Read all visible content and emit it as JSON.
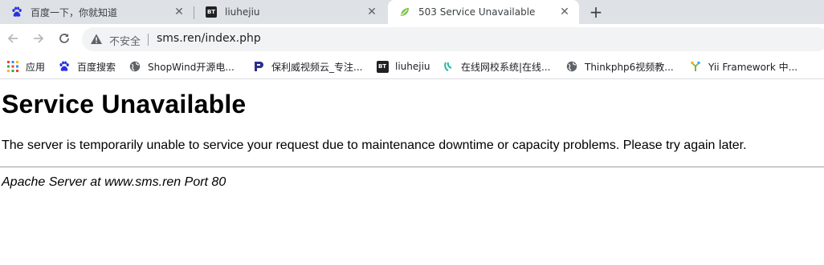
{
  "tabs": [
    {
      "title": "百度一下，你就知道",
      "icon": "baidu-paw-icon"
    },
    {
      "title": "liuhejiu",
      "icon": "bt-icon"
    },
    {
      "title": "503 Service Unavailable",
      "icon": "leaf-icon",
      "active": true
    }
  ],
  "tab_close_glyph": "✕",
  "new_tab_glyph": "+",
  "bt_badge": "BT",
  "address_bar": {
    "security_label": "不安全",
    "url": "sms.ren/index.php"
  },
  "bookmarks": [
    {
      "label": "应用",
      "icon": "apps-grid-icon"
    },
    {
      "label": "百度搜索",
      "icon": "baidu-paw-icon"
    },
    {
      "label": "ShopWind开源电...",
      "icon": "globe-icon"
    },
    {
      "label": "保利威视频云_专注...",
      "icon": "polyv-icon"
    },
    {
      "label": "liuhejiu",
      "icon": "bt-icon"
    },
    {
      "label": "在线网校系统|在线...",
      "icon": "edu-icon"
    },
    {
      "label": "Thinkphp6视频教...",
      "icon": "globe-icon"
    },
    {
      "label": "Yii Framework 中...",
      "icon": "yii-icon"
    }
  ],
  "page": {
    "heading": "Service Unavailable",
    "message": "The server is temporarily unable to service your request due to maintenance downtime or capacity problems. Please try again later.",
    "address": "Apache Server at www.sms.ren Port 80"
  },
  "colors": {
    "tabstrip_bg": "#dee1e6",
    "omnibox_bg": "#f1f3f4",
    "baidu_blue": "#2932e1",
    "leaf_green": "#7cc242"
  }
}
